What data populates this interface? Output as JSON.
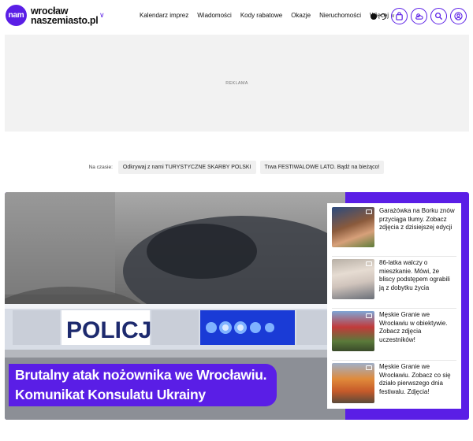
{
  "logo": {
    "badge": "nam",
    "line1": "wrocław",
    "line2": "naszemiasto.pl"
  },
  "nav": {
    "items": [
      "Kalendarz imprez",
      "Wiadomości",
      "Kody rabatowe",
      "Okazje",
      "Nieruchomości"
    ],
    "more": "Więcej"
  },
  "icons": {
    "theme": "theme-toggle-icon",
    "bag": "shopping-bag-icon",
    "weather": "weather-icon",
    "search": "search-icon",
    "user": "user-icon"
  },
  "ad": {
    "label": "REKLAMA"
  },
  "trending": {
    "label": "Na czasie:",
    "chips": [
      "Odkrywaj z nami TURYSTYCZNE SKARBY POLSKI",
      "Trwa FESTIWALOWE LATO. Bądź na bieżąco!"
    ]
  },
  "hero": {
    "title": "Brutalny atak nożownika we Wrocławiu. Komunikat Konsulatu Ukrainy",
    "sign_text": "POLICJA"
  },
  "side_articles": [
    {
      "title": "Garażówka na Borku znów przyciąga tłumy. Zobacz zdjęcia z dzisiejszej edycji"
    },
    {
      "title": "86-latka walczy o mieszkanie. Mówi, że bliscy podstępem ograbili ją z dobytku życia"
    },
    {
      "title": "Męskie Granie we Wrocławiu w obiektywie. Zobacz zdjęcia uczestników!"
    },
    {
      "title": "Męskie Granie we Wrocławiu. Zobacz co się działo pierwszego dnia festiwalu. Zdjęcia!"
    }
  ],
  "colors": {
    "brand": "#5a1ee6"
  }
}
